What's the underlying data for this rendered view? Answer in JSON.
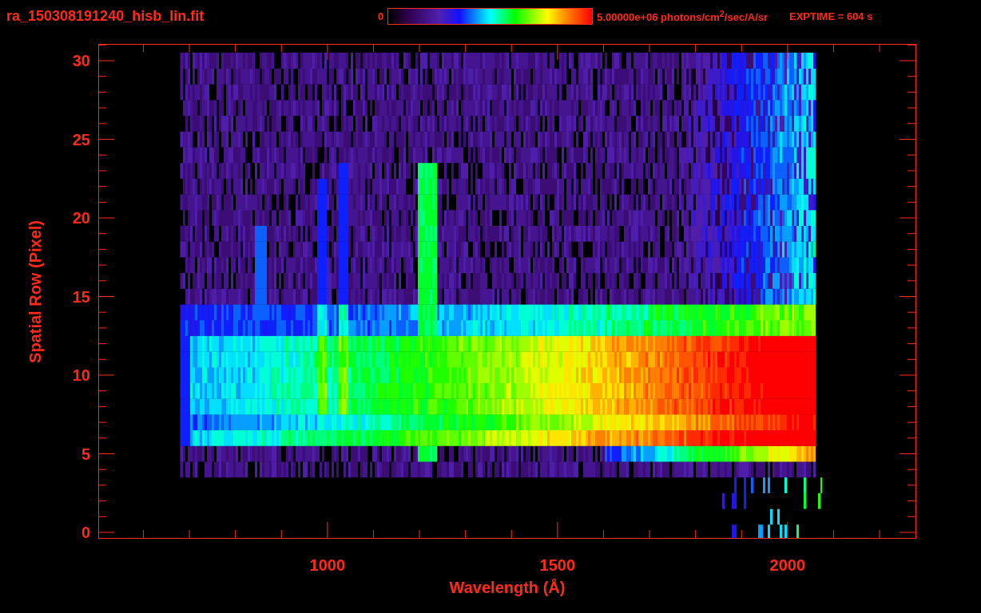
{
  "title": "ra_150308191240_hisb_lin.fit",
  "colorbar": {
    "min_label": "0",
    "max_label": "5.00000e+06 photons/cm$^{2}$/sec/A/sr"
  },
  "exposure": "EXPTIME = 604 s",
  "plot": {
    "x_axis": {
      "label": "Wavelength (Å)",
      "ticks": [
        "1000",
        "1500",
        "2000"
      ]
    },
    "y_axis": {
      "label": "Spatial Row (Pixel)",
      "ticks": [
        "30",
        "25",
        "20",
        "15",
        "10",
        "5",
        "0"
      ]
    }
  }
}
